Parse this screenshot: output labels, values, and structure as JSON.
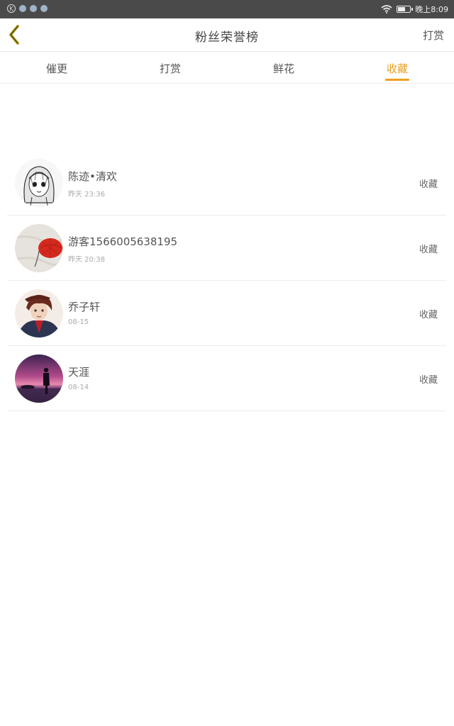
{
  "status_bar": {
    "time": "晚上8:09"
  },
  "header": {
    "title": "粉丝荣誉榜",
    "action": "打赏"
  },
  "tabs": [
    {
      "label": "催更"
    },
    {
      "label": "打赏"
    },
    {
      "label": "鲜花"
    },
    {
      "label": "收藏"
    }
  ],
  "active_tab": "收藏",
  "list": [
    {
      "name": "陈迹•清欢",
      "time": "昨天 23:36",
      "action": "收藏"
    },
    {
      "name": "游客1566005638195",
      "time": "昨天 20:38",
      "action": "收藏"
    },
    {
      "name": "乔子轩",
      "time": "08-15",
      "action": "收藏"
    },
    {
      "name": "天涯",
      "time": "08-14",
      "action": "收藏"
    }
  ],
  "colors": {
    "accent": "#f0a020",
    "status_bar": "#4a4a4a"
  }
}
